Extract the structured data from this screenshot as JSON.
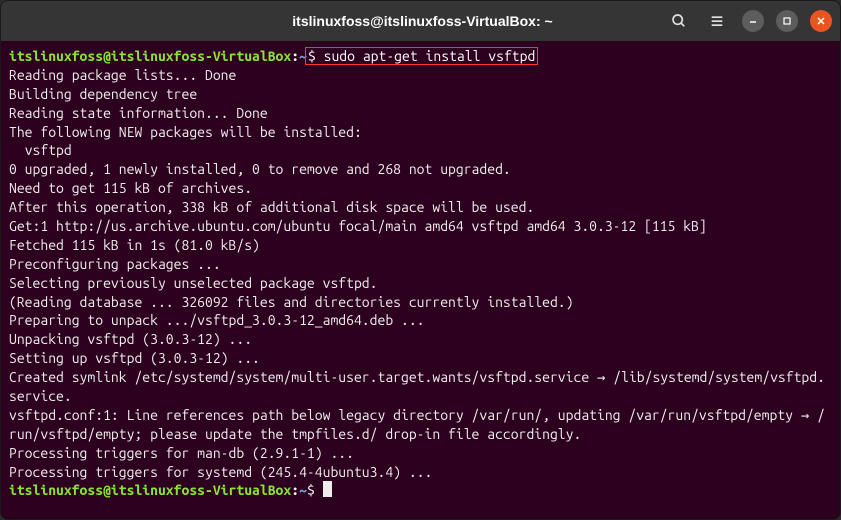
{
  "titlebar": {
    "title": "itslinuxfoss@itslinuxfoss-VirtualBox: ~"
  },
  "prompt1": {
    "userhost": "itslinuxfoss@itslinuxfoss-VirtualBox",
    "colon": ":",
    "path": "~",
    "dollar": "$ ",
    "command": "sudo apt-get install vsftpd"
  },
  "output": {
    "l0": "Reading package lists... Done",
    "l1": "Building dependency tree",
    "l2": "Reading state information... Done",
    "l3": "The following NEW packages will be installed:",
    "l4": "  vsftpd",
    "l5": "0 upgraded, 1 newly installed, 0 to remove and 268 not upgraded.",
    "l6": "Need to get 115 kB of archives.",
    "l7": "After this operation, 338 kB of additional disk space will be used.",
    "l8": "Get:1 http://us.archive.ubuntu.com/ubuntu focal/main amd64 vsftpd amd64 3.0.3-12 [115 kB]",
    "l9": "Fetched 115 kB in 1s (81.0 kB/s)",
    "l10": "Preconfiguring packages ...",
    "l11": "Selecting previously unselected package vsftpd.",
    "l12": "(Reading database ... 326092 files and directories currently installed.)",
    "l13": "Preparing to unpack .../vsftpd_3.0.3-12_amd64.deb ...",
    "l14": "Unpacking vsftpd (3.0.3-12) ...",
    "l15": "Setting up vsftpd (3.0.3-12) ...",
    "l16": "Created symlink /etc/systemd/system/multi-user.target.wants/vsftpd.service → /lib/systemd/system/vsftpd.service.",
    "l17": "vsftpd.conf:1: Line references path below legacy directory /var/run/, updating /var/run/vsftpd/empty → /run/vsftpd/empty; please update the tmpfiles.d/ drop-in file accordingly.",
    "l18": "Processing triggers for man-db (2.9.1-1) ...",
    "l19": "Processing triggers for systemd (245.4-4ubuntu3.4) ..."
  },
  "prompt2": {
    "userhost": "itslinuxfoss@itslinuxfoss-VirtualBox",
    "colon": ":",
    "path": "~",
    "dollar": "$ "
  }
}
